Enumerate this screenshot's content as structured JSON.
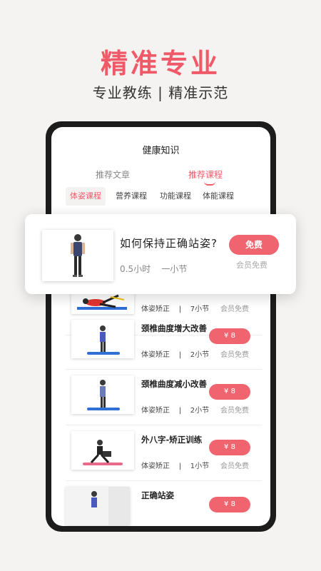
{
  "headline": "精准专业",
  "subline": "专业教练 | 精准示范",
  "screen": {
    "title": "健康知识",
    "tabs": [
      {
        "label": "推荐文章"
      },
      {
        "label": "推荐课程"
      }
    ],
    "chips": [
      {
        "label": "体姿课程"
      },
      {
        "label": "营养课程"
      },
      {
        "label": "功能课程"
      },
      {
        "label": "体能课程"
      }
    ]
  },
  "popup": {
    "title": "如何保持正确站姿?",
    "meta": "0.5小时    一小节",
    "button": "免费",
    "member": "会员免费"
  },
  "courses": [
    {
      "title": "",
      "meta": "体姿矫正    |    7小节",
      "price": "",
      "member": "会员免费"
    },
    {
      "title": "颈椎曲度增大改善",
      "meta": "体姿矫正    |    2小节",
      "price": "¥ 8",
      "member": "会员免费"
    },
    {
      "title": "颈椎曲度减小改善",
      "meta": "体姿矫正    |    2小节",
      "price": "¥ 8",
      "member": "会员免费"
    },
    {
      "title": "外八字-矫正训练",
      "meta": "体姿矫正    |    1小节",
      "price": "¥ 8",
      "member": "会员免费"
    },
    {
      "title": "正确站姿",
      "meta": "",
      "price": "¥ 8",
      "member": ""
    }
  ],
  "colors": {
    "accent": "#f05a68",
    "button": "#f06470",
    "mat_blue": "#2f6fd6",
    "mat_pink": "#e86a8a"
  }
}
